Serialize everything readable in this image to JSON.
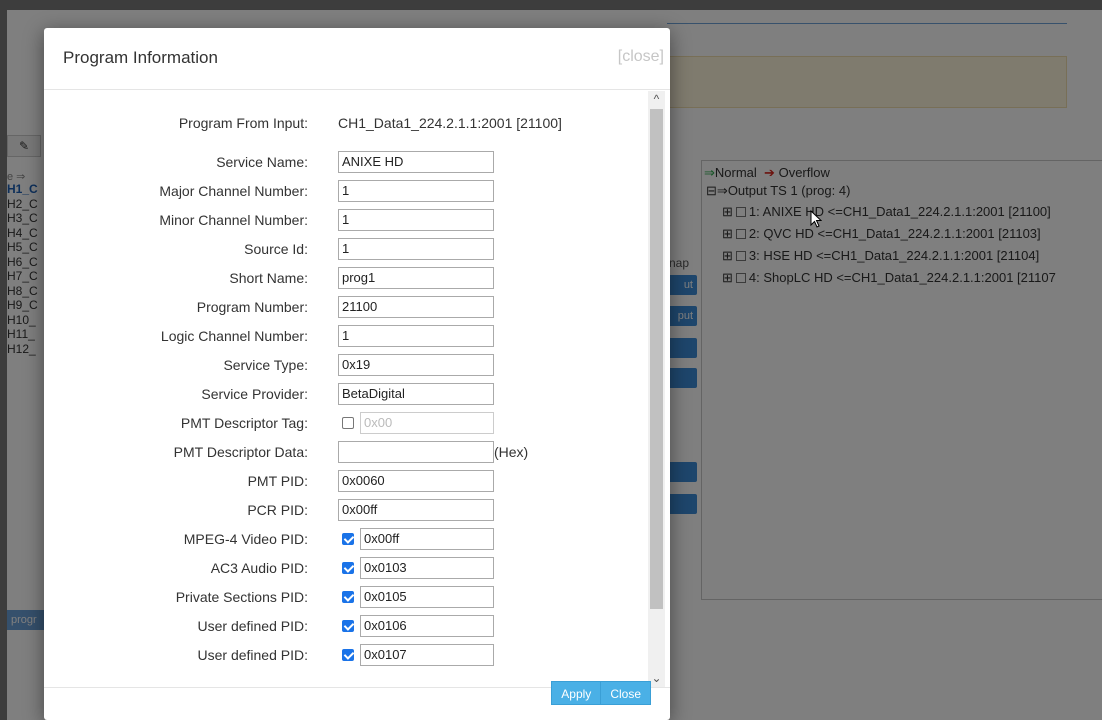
{
  "background": {
    "tree": {
      "legend_normal": "Normal",
      "legend_overflow": "Overflow",
      "root_label": "Output TS 1 (prog: 4)",
      "items": [
        {
          "label": "1: ANIXE HD <=CH1_Data1_224.2.1.1:2001 [21100]"
        },
        {
          "label": "2: QVC HD <=CH1_Data1_224.2.1.1:2001 [21103]"
        },
        {
          "label": "3: HSE HD <=CH1_Data1_224.2.1.1:2001 [21104]"
        },
        {
          "label": "4: ShopLC HD <=CH1_Data1_224.2.1.1:2001 [21107"
        }
      ]
    },
    "channels": [
      "H1_C",
      "H2_C",
      "H3_C",
      "H4_C",
      "H5_C",
      "H6_C",
      "H7_C",
      "H8_C",
      "H9_C",
      "H10_",
      "H11_",
      "H12_"
    ],
    "left_legend": "e ⇒",
    "map_label": "nap",
    "side_buttons": [
      "ut",
      "put"
    ],
    "prog_tag": "progr"
  },
  "modal": {
    "title": "Program Information",
    "close_link": "[close]",
    "program_from_input_label": "Program From Input:",
    "program_from_input_value": "CH1_Data1_224.2.1.1:2001 [21100]",
    "fields": {
      "service_name": {
        "label": "Service Name:",
        "value": "ANIXE HD"
      },
      "major_channel": {
        "label": "Major Channel Number:",
        "value": "1"
      },
      "minor_channel": {
        "label": "Minor Channel Number:",
        "value": "1"
      },
      "source_id": {
        "label": "Source Id:",
        "value": "1"
      },
      "short_name": {
        "label": "Short Name:",
        "value": "prog1"
      },
      "program_number": {
        "label": "Program Number:",
        "value": "21100"
      },
      "logic_channel": {
        "label": "Logic Channel Number:",
        "value": "1"
      },
      "service_type": {
        "label": "Service Type:",
        "value": "0x19"
      },
      "service_provider": {
        "label": "Service Provider:",
        "value": "BetaDigital"
      },
      "pmt_descriptor_tag": {
        "label": "PMT Descriptor Tag:",
        "value": "0x00",
        "checked": false
      },
      "pmt_descriptor_data": {
        "label": "PMT Descriptor Data:",
        "value": "",
        "suffix": "(Hex)"
      },
      "pmt_pid": {
        "label": "PMT PID:",
        "value": "0x0060"
      },
      "pcr_pid": {
        "label": "PCR PID:",
        "value": "0x00ff"
      },
      "mpeg4_video_pid": {
        "label": "MPEG-4 Video PID:",
        "value": "0x00ff",
        "checked": true
      },
      "ac3_audio_pid": {
        "label": "AC3 Audio PID:",
        "value": "0x0103",
        "checked": true
      },
      "private_sections_pid": {
        "label": "Private Sections PID:",
        "value": "0x0105",
        "checked": true
      },
      "user_defined_pid_1": {
        "label": "User defined PID:",
        "value": "0x0106",
        "checked": true
      },
      "user_defined_pid_2": {
        "label": "User defined PID:",
        "value": "0x0107",
        "checked": true
      }
    },
    "buttons": {
      "apply": "Apply",
      "close": "Close"
    }
  }
}
